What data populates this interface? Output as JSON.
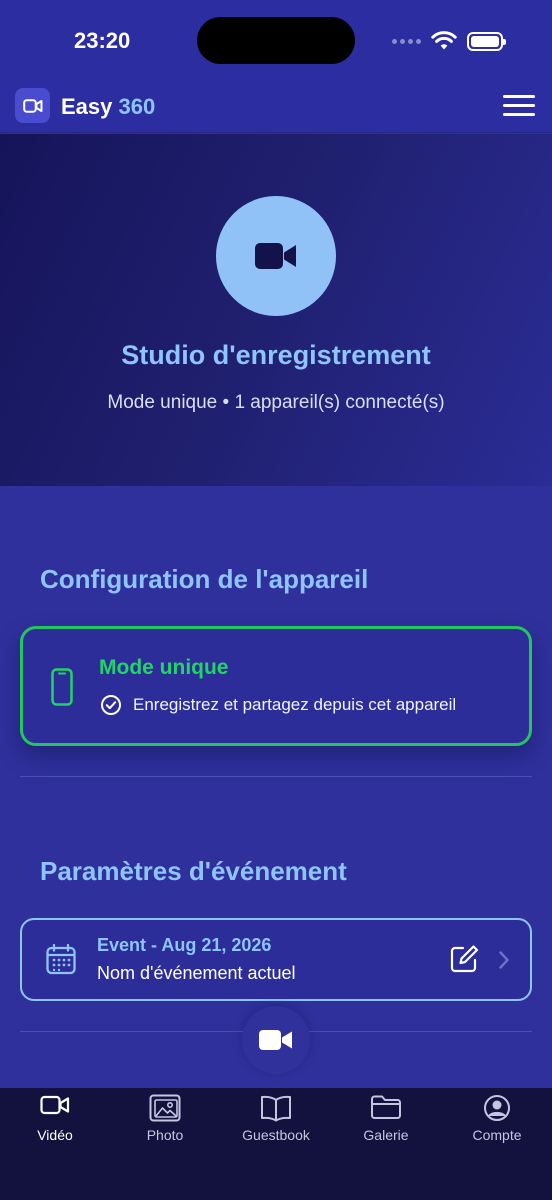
{
  "status_bar": {
    "time": "23:20"
  },
  "header": {
    "title_part1": "Easy",
    "title_part2": "360"
  },
  "hero": {
    "title": "Studio d'enregistrement",
    "subtitle": "Mode unique • 1 appareil(s) connecté(s)"
  },
  "device_config": {
    "section_title": "Configuration de l'appareil",
    "mode_title": "Mode unique",
    "mode_description": "Enregistrez et partagez depuis cet appareil"
  },
  "event_settings": {
    "section_title": "Paramètres d'événement",
    "event_title": "Event - Aug 21, 2026",
    "event_subtitle": "Nom d'événement actuel"
  },
  "tabs": [
    {
      "label": "Vidéo",
      "icon": "video-icon",
      "active": true
    },
    {
      "label": "Photo",
      "icon": "image-icon",
      "active": false
    },
    {
      "label": "Guestbook",
      "icon": "book-icon",
      "active": false
    },
    {
      "label": "Galerie",
      "icon": "folder-icon",
      "active": false
    },
    {
      "label": "Compte",
      "icon": "user-circle-icon",
      "active": false
    }
  ],
  "colors": {
    "background": "#2f309c",
    "accent_blue": "#8ec5ff",
    "accent_green": "#22c55e",
    "tab_bar": "#13123f"
  }
}
